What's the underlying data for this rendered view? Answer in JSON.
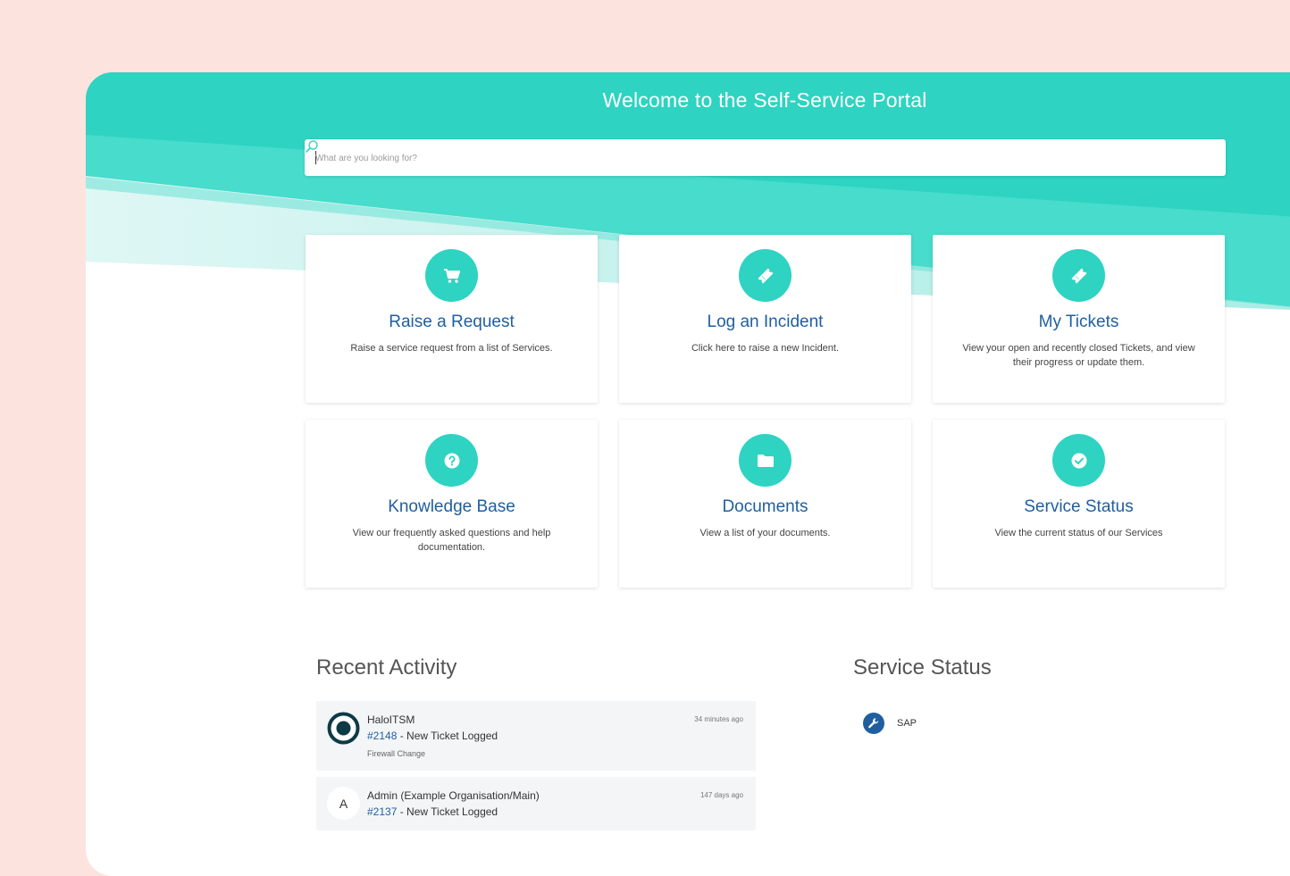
{
  "header": {
    "title": "Welcome to the Self-Service Portal"
  },
  "search": {
    "placeholder": "What are you looking for?",
    "icon": "search-icon"
  },
  "cards": [
    {
      "title": "Raise a Request",
      "description": "Raise a service request from a list of Services.",
      "icon": "cart-icon"
    },
    {
      "title": "Log an Incident",
      "description": "Click here to raise a new Incident.",
      "icon": "ticket-icon"
    },
    {
      "title": "My Tickets",
      "description": "View your open and recently closed Tickets, and view their progress or update them.",
      "icon": "ticket-icon"
    },
    {
      "title": "Knowledge Base",
      "description": "View our frequently asked questions and help documentation.",
      "icon": "question-icon"
    },
    {
      "title": "Documents",
      "description": "View a list of your documents.",
      "icon": "folder-icon"
    },
    {
      "title": "Service Status",
      "description": "View the current status of our Services",
      "icon": "check-circle-icon"
    }
  ],
  "recent_activity": {
    "heading": "Recent Activity",
    "items": [
      {
        "who": "HaloITSM",
        "ticket": "#2148",
        "action": " - New Ticket Logged",
        "detail": "Firewall Change",
        "time": "34 minutes ago"
      },
      {
        "avatar_letter": "A",
        "who": "Admin (Example Organisation/Main)",
        "ticket": "#2137",
        "action": " - New Ticket Logged",
        "time": "147 days ago"
      }
    ]
  },
  "service_status": {
    "heading": "Service Status",
    "items": [
      {
        "name": "SAP",
        "icon": "wrench-icon"
      }
    ]
  },
  "colors": {
    "accent": "#2ed3c2",
    "link": "#1f5fa0",
    "background": "#fde3de"
  }
}
